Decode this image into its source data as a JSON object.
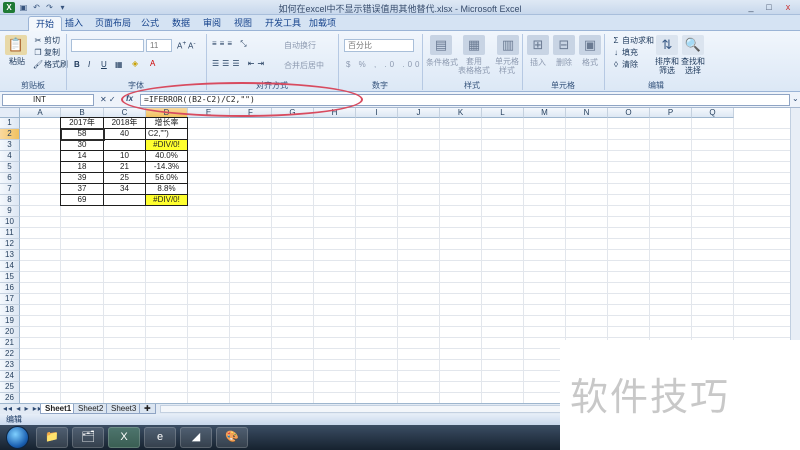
{
  "window": {
    "title": "如何在excel中不显示错误值用其他替代.xlsx - Microsoft Excel",
    "qat": [
      "save-icon",
      "undo-icon",
      "redo-icon",
      "customize-icon"
    ],
    "controls": [
      "_",
      "□",
      "x"
    ]
  },
  "tabs": [
    "开始",
    "插入",
    "页面布局",
    "公式",
    "数据",
    "审阅",
    "视图",
    "开发工具",
    "加载项"
  ],
  "active_tab": "开始",
  "ribbon": {
    "clipboard": {
      "paste": "粘贴",
      "cut": "剪切",
      "copy": "复制",
      "format_painter": "格式刷",
      "label": "剪贴板"
    },
    "font": {
      "font_name": "",
      "font_size": "11",
      "bold": "B",
      "italic": "I",
      "underline": "U",
      "label": "字体"
    },
    "alignment": {
      "wrap": "自动换行",
      "merge": "合并后居中",
      "label": "对齐方式"
    },
    "number": {
      "format": "百分比",
      "label": "数字"
    },
    "styles": {
      "conditional": "条件格式",
      "table": "套用\n表格格式",
      "cell": "单元格\n样式",
      "label": "样式"
    },
    "cells": {
      "insert": "插入",
      "delete": "删除",
      "format": "格式",
      "label": "单元格"
    },
    "editing": {
      "autosum": "自动求和",
      "fill": "填充",
      "clear": "清除",
      "sort": "排序和\n筛选",
      "find": "查找和\n选择",
      "label": "编辑"
    }
  },
  "formula_bar": {
    "name_box": "INT",
    "fx": "fx",
    "formula": "=IFERROR((B2-C2)/C2,\"\")"
  },
  "columns": [
    "A",
    "B",
    "C",
    "D",
    "E",
    "F",
    "G",
    "H",
    "I",
    "J",
    "K",
    "L",
    "M",
    "N",
    "O",
    "P",
    "Q"
  ],
  "rows": [
    "1",
    "2",
    "3",
    "4",
    "5",
    "6",
    "7",
    "8",
    "9",
    "10",
    "11",
    "12",
    "13",
    "14",
    "15",
    "16",
    "17",
    "18",
    "19",
    "20",
    "21",
    "22",
    "23",
    "24",
    "25",
    "26"
  ],
  "table": {
    "headers": [
      "2017年",
      "2018年",
      "增长率"
    ],
    "data": [
      [
        "58",
        "40",
        "C2,\"\")"
      ],
      [
        "30",
        "",
        "#DIV/0!"
      ],
      [
        "14",
        "10",
        "40.0%"
      ],
      [
        "18",
        "21",
        "-14.3%"
      ],
      [
        "39",
        "25",
        "56.0%"
      ],
      [
        "37",
        "34",
        "8.8%"
      ],
      [
        "69",
        "",
        "#DIV/0!"
      ]
    ]
  },
  "sheets": [
    "Sheet1",
    "Sheet2",
    "Sheet3"
  ],
  "status": "编辑",
  "taskbar": [
    "folder-icon",
    "explorer-icon",
    "excel-icon",
    "ie-icon",
    "app-icon",
    "paint-icon"
  ],
  "watermark": "软件技巧"
}
